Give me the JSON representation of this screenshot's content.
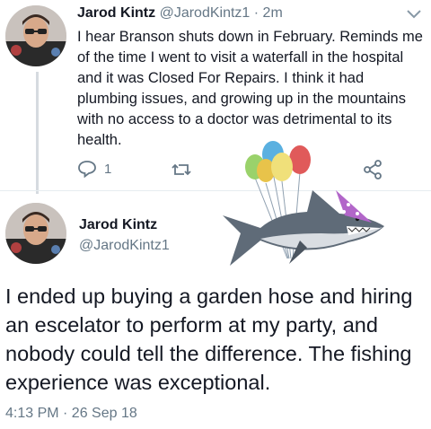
{
  "reply_tweet": {
    "author_name": "Jarod Kintz",
    "author_handle": "@JarodKintz1",
    "separator": "·",
    "age": "2m",
    "text": "I hear Branson shuts down in February. Reminds me of the time I went to visit a waterfall in the hospital and it was Closed For Repairs. I think it had plumbing issues, and growing up in the mountains with no access to a doctor was detrimental to its health.",
    "reply_count": "1",
    "icons": [
      "reply-icon",
      "retweet-icon",
      "share-icon"
    ]
  },
  "main_tweet": {
    "author_name": "Jarod Kintz",
    "author_handle": "@JarodKintz1",
    "text": "I ended up buying a garden hose and hiring an escelator to perform at my party, and nobody could tell the difference. The fishing experience was exceptional.",
    "timestamp": "4:13 PM · 26 Sep 18"
  },
  "sticker": {
    "description_icon": "party-shark-with-balloons",
    "balloon_colors": [
      "#e8c34a",
      "#5ab0e0",
      "#9ad26b",
      "#e05a5a",
      "#f0e07a"
    ],
    "hat_color": "#b266c9"
  }
}
